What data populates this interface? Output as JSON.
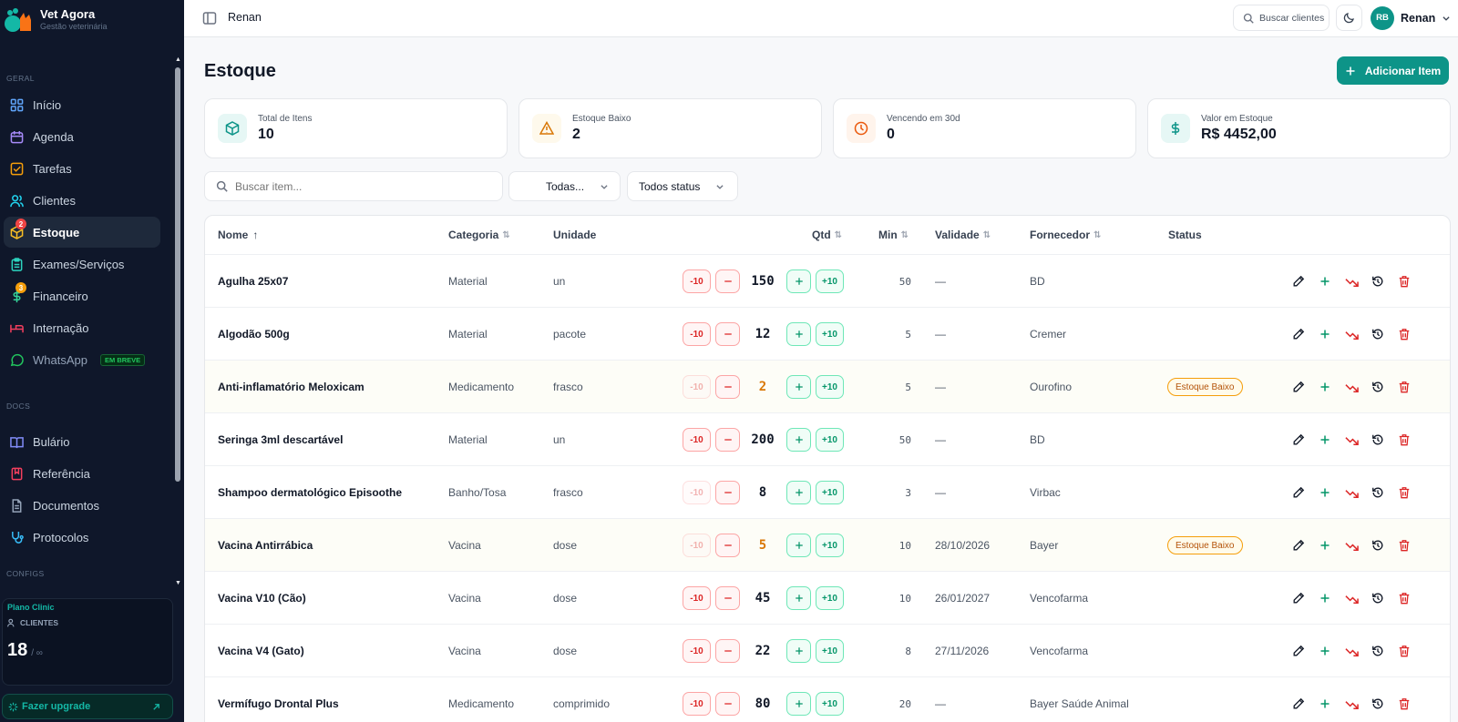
{
  "brand": {
    "name": "Vet Agora",
    "subtitle": "Gestão veterinária"
  },
  "sidebar": {
    "sections": {
      "geral": "GERAL",
      "docs": "DOCS",
      "configs": "CONFIGS"
    },
    "items": [
      {
        "label": "Início",
        "icon": "grid-icon"
      },
      {
        "label": "Agenda",
        "icon": "calendar-icon"
      },
      {
        "label": "Tarefas",
        "icon": "checkbox-icon"
      },
      {
        "label": "Clientes",
        "icon": "users-icon"
      },
      {
        "label": "Estoque",
        "icon": "package-icon",
        "badge": "2",
        "active": true
      },
      {
        "label": "Exames/Serviços",
        "icon": "clipboard-icon"
      },
      {
        "label": "Financeiro",
        "icon": "dollar-icon",
        "badge": "3"
      },
      {
        "label": "Internação",
        "icon": "bed-icon"
      },
      {
        "label": "WhatsApp",
        "icon": "whatsapp-icon",
        "tag": "EM BREVE"
      }
    ],
    "docs": [
      {
        "label": "Bulário",
        "icon": "book-icon"
      },
      {
        "label": "Referência",
        "icon": "bookmark-book-icon"
      },
      {
        "label": "Documentos",
        "icon": "file-icon"
      },
      {
        "label": "Protocolos",
        "icon": "stethoscope-icon"
      }
    ],
    "plan": {
      "name": "Plano Clinic",
      "label": "CLIENTES",
      "count": "18",
      "limit": "/ ∞"
    },
    "upgrade": "Fazer upgrade"
  },
  "topbar": {
    "breadcrumb": "Renan",
    "search_label": "Buscar clientes",
    "avatar": "RB",
    "user": "Renan"
  },
  "page": {
    "title": "Estoque",
    "add_button": "Adicionar Item"
  },
  "stats": [
    {
      "label": "Total de Itens",
      "value": "10"
    },
    {
      "label": "Estoque Baixo",
      "value": "2"
    },
    {
      "label": "Vencendo em 30d",
      "value": "0"
    },
    {
      "label": "Valor em Estoque",
      "value": "R$ 4452,00"
    }
  ],
  "filters": {
    "search_placeholder": "Buscar item...",
    "category": "Todas...",
    "status": "Todos status"
  },
  "table": {
    "headers": {
      "nome": "Nome",
      "categoria": "Categoria",
      "unidade": "Unidade",
      "qtd": "Qtd",
      "min": "Min",
      "validade": "Validade",
      "fornecedor": "Fornecedor",
      "status": "Status"
    },
    "minus10": "-10",
    "plus10": "+10",
    "rows": [
      {
        "name": "Agulha 25x07",
        "category": "Material",
        "unit": "un",
        "qty": "150",
        "min": "50",
        "validity": "—",
        "supplier": "BD",
        "status": ""
      },
      {
        "name": "Algodão 500g",
        "category": "Material",
        "unit": "pacote",
        "qty": "12",
        "min": "5",
        "validity": "—",
        "supplier": "Cremer",
        "status": ""
      },
      {
        "name": "Anti-inflamatório Meloxicam",
        "category": "Medicamento",
        "unit": "frasco",
        "qty": "2",
        "min": "5",
        "validity": "—",
        "supplier": "Ourofino",
        "status": "Estoque Baixo"
      },
      {
        "name": "Seringa 3ml descartável",
        "category": "Material",
        "unit": "un",
        "qty": "200",
        "min": "50",
        "validity": "—",
        "supplier": "BD",
        "status": ""
      },
      {
        "name": "Shampoo dermatológico Episoothe",
        "category": "Banho/Tosa",
        "unit": "frasco",
        "qty": "8",
        "min": "3",
        "validity": "—",
        "supplier": "Virbac",
        "status": ""
      },
      {
        "name": "Vacina Antirrábica",
        "category": "Vacina",
        "unit": "dose",
        "qty": "5",
        "min": "10",
        "validity": "28/10/2026",
        "supplier": "Bayer",
        "status": "Estoque Baixo"
      },
      {
        "name": "Vacina V10 (Cão)",
        "category": "Vacina",
        "unit": "dose",
        "qty": "45",
        "min": "10",
        "validity": "26/01/2027",
        "supplier": "Vencofarma",
        "status": ""
      },
      {
        "name": "Vacina V4 (Gato)",
        "category": "Vacina",
        "unit": "dose",
        "qty": "22",
        "min": "8",
        "validity": "27/11/2026",
        "supplier": "Vencofarma",
        "status": ""
      },
      {
        "name": "Vermífugo Drontal Plus",
        "category": "Medicamento",
        "unit": "comprimido",
        "qty": "80",
        "min": "20",
        "validity": "—",
        "supplier": "Bayer Saúde Animal",
        "status": ""
      }
    ]
  },
  "colors": {
    "accent": "#0d9488",
    "sidebar_bg": "#0f172a",
    "warning": "#f59e0b",
    "danger": "#dc2626"
  }
}
